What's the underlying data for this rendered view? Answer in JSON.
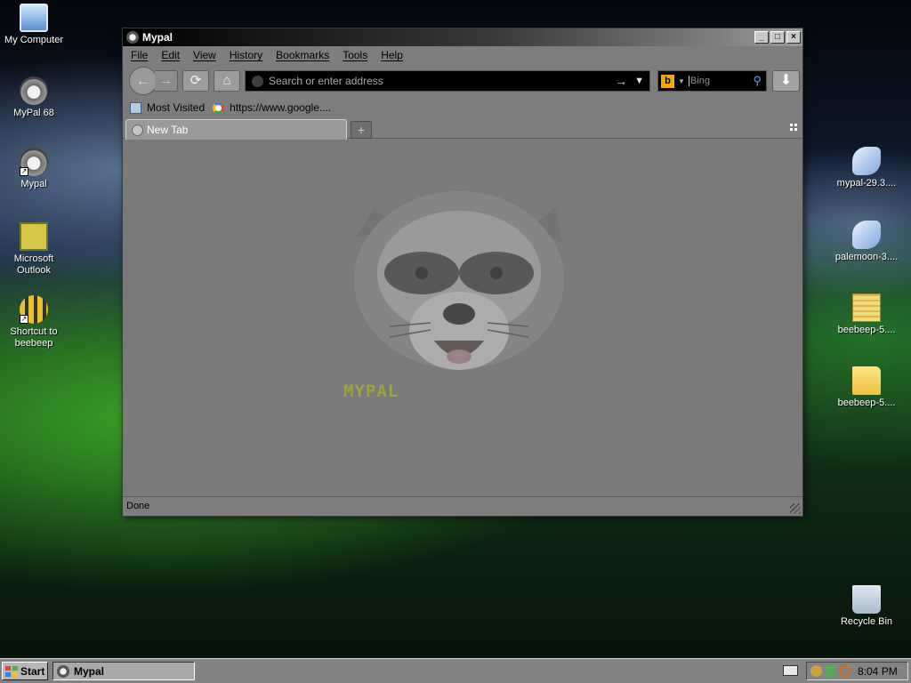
{
  "desktop": {
    "left_icons": [
      {
        "label": "My Computer",
        "icon": "my-computer-icon"
      },
      {
        "label": "MyPal 68",
        "icon": "mypal-raccoon-icon"
      },
      {
        "label": "Mypal",
        "icon": "mypal-raccoon-icon"
      },
      {
        "label": "Microsoft Outlook",
        "icon": "outlook-icon"
      },
      {
        "label": "Shortcut to beebeep",
        "icon": "beebeep-bee-icon"
      }
    ],
    "right_icons": [
      {
        "label": "mypal-29.3....",
        "icon": "installer-icon"
      },
      {
        "label": "palemoon-3....",
        "icon": "installer-icon"
      },
      {
        "label": "beebeep-5....",
        "icon": "zip-icon"
      },
      {
        "label": "beebeep-5....",
        "icon": "folder-icon"
      },
      {
        "label": "Recycle Bin",
        "icon": "recycle-bin-icon"
      }
    ]
  },
  "window": {
    "title": "Mypal",
    "minimize": "_",
    "maximize": "□",
    "close": "×"
  },
  "menu": [
    "File",
    "Edit",
    "View",
    "History",
    "Bookmarks",
    "Tools",
    "Help"
  ],
  "navbar": {
    "back": "←",
    "forward": "→",
    "reload": "⟳",
    "home": "⌂",
    "url_placeholder": "Search or enter address",
    "go": "→",
    "dropdown": "▼",
    "search_engine": "b",
    "search_placeholder": "Bing",
    "search_icon": "⚲",
    "download": "⬇"
  },
  "bookmarks": [
    {
      "label": "Most Visited",
      "icon": "most-visited-icon"
    },
    {
      "label": "https://www.google....",
      "icon": "google-icon"
    }
  ],
  "tabs": [
    {
      "label": "New Tab",
      "active": true
    }
  ],
  "new_tab_button": "+",
  "content": {
    "logo_text": "MYPAL"
  },
  "status": "Done",
  "taskbar": {
    "start": "Start",
    "task": "Mypal",
    "clock": "8:04 PM"
  }
}
